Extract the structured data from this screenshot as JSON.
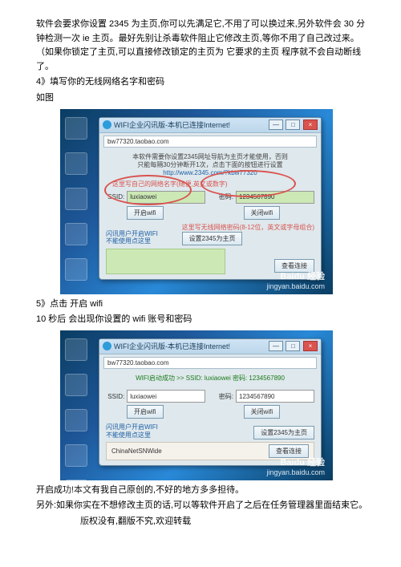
{
  "p1": "软件会要求你设置 2345 为主页,你可以先满足它,不用了可以换过来,另外软件会 30 分钟检测一次 ie 主页。最好先别让杀毒软件阻止它修改主页,等你不用了自己改过来。（如果你锁定了主页,可以直接修改锁定的主页为 它要求的主页   程序就不会自动断线了。",
  "p2": "4》填写你的无线网络名字和密码",
  "p3": "如图",
  "p4": "5》点击  开启 wifi",
  "p5": "10 秒后 会出现你设置的 wifi 账号和密码",
  "p6": "开启成功!本文有我自己原创的,不好的地方多多担待。",
  "p7": "另外:如果你实在不想修改主页的话,可以等软件开启了之后在任务管理器里面结束它。",
  "p8": "版权没有,翻版不究,欢迎转载",
  "win1": {
    "title": "WIFI企业闪讯版-本机已连接Internet!",
    "url": "bw77320.taobao.com",
    "msg1": "本软件需要你设置2345网址导航为主页才能使用，否则",
    "msg2": "只能每隔30分钟断开1次，点击下面的按钮进行设置",
    "msg3": "http://www.2345.com/?kbw77320",
    "anno_left": "这里写自己的网络名字(随便,英文或数字)",
    "ssid_label": "SSID:",
    "ssid_value": "luxiaowei",
    "pwd_label": "密码:",
    "pwd_value": "1234567890",
    "btn_start": "开启wifi",
    "btn_close": "关闭wifi",
    "anno_right": "这里写无线网络密码(8-12位，英文或字母组合)",
    "tip1": "闪讯用户开启WIFI",
    "tip2": "不能使用点这里",
    "btn_set": "设置2345为主页",
    "btn_view": "查看连接"
  },
  "win2": {
    "title": "WIFI企业闪讯版-本机已连接Internet!",
    "url": "bw77320.taobao.com",
    "status": "WIFI启动成功 >> SSID: luxiaowei 密码: 1234567890",
    "ssid_label": "SSID:",
    "ssid_value": "luxiaowei",
    "pwd_label": "密码:",
    "pwd_value": "1234567890",
    "btn_start": "开启wifi",
    "btn_close": "关闭wifi",
    "tip1": "闪讯用户开启WIFI",
    "tip2": "不能使用点这里",
    "btn_set": "设置2345为主页",
    "net": "ChinaNetSNWide",
    "btn_view": "查看连接"
  },
  "wm": {
    "brand": "Baidu 经验",
    "url": "jingyan.baidu.com"
  }
}
